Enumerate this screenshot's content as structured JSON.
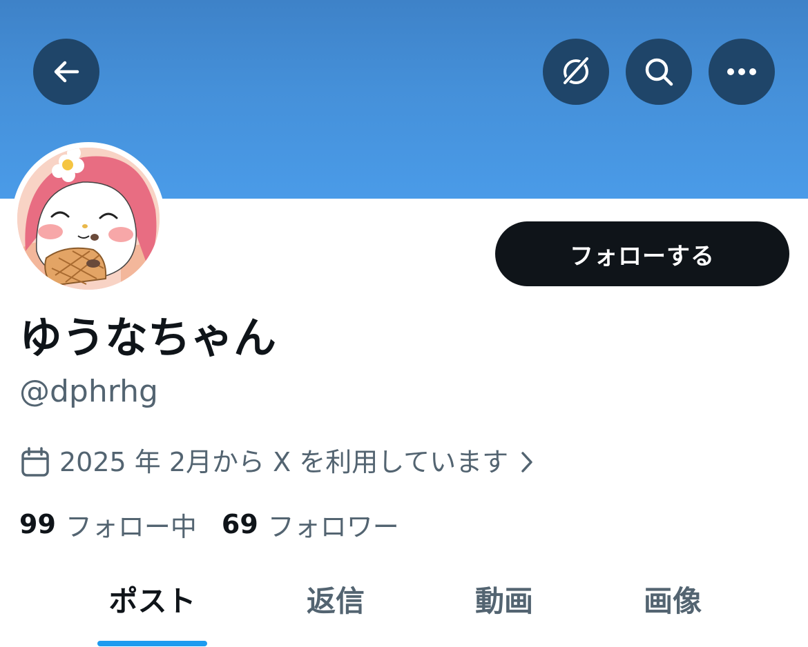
{
  "header": {
    "back_icon": "arrow-left-icon",
    "grok_icon": "grok-icon",
    "search_icon": "search-icon",
    "more_icon": "more-horizontal-icon",
    "banner_color": "#4a9be8"
  },
  "profile": {
    "display_name": "ゆうなちゃん",
    "handle": "@dphrhg",
    "follow_label": "フォローする",
    "joined_icon": "calendar-icon",
    "joined_text": "2025 年 2月から X を利用しています",
    "following_count": "99",
    "following_label": "フォロー中",
    "followers_count": "69",
    "followers_label": "フォロワー"
  },
  "tabs": [
    {
      "label": "ポスト",
      "active": true
    },
    {
      "label": "返信",
      "active": false
    },
    {
      "label": "動画",
      "active": false
    },
    {
      "label": "画像",
      "active": false
    }
  ],
  "colors": {
    "accent": "#1d9bf0",
    "button_dark": "#0f1419",
    "secondary_text": "#536471"
  }
}
